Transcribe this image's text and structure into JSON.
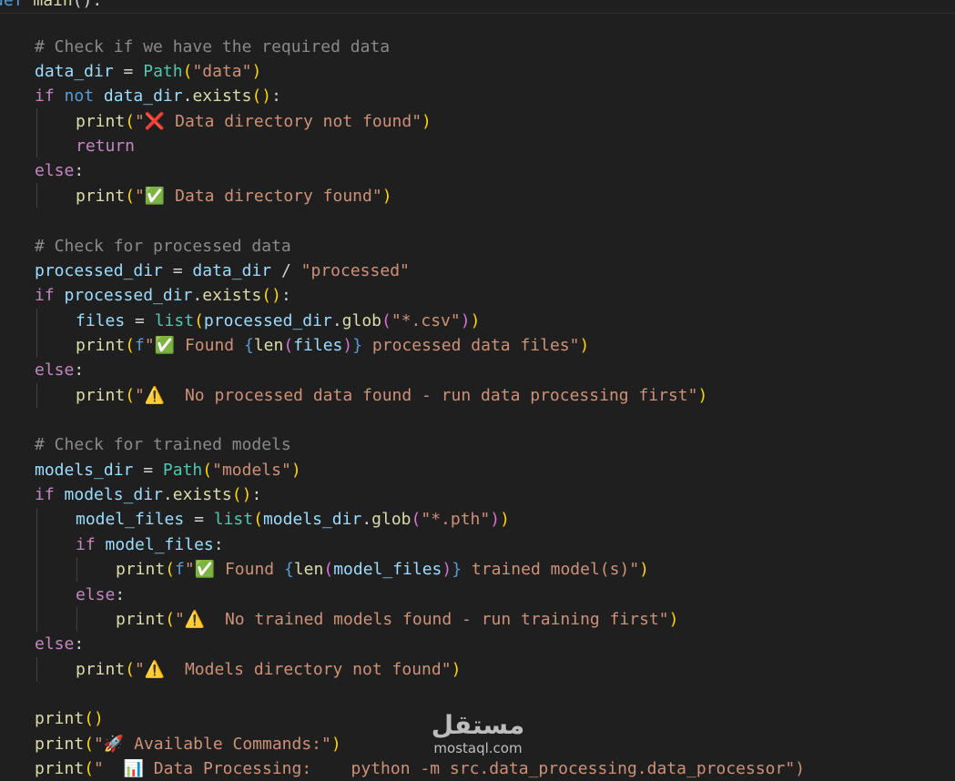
{
  "editor": {
    "sticky_header": {
      "kw": "def",
      "fn": "main",
      "rest": "():"
    },
    "cm1": "# Check if we have the required data",
    "cm2": "# Check for processed data",
    "cm3": "# Check for trained models",
    "s_data": "\"data\"",
    "s_not_found": "\"❌ Data directory not found\"",
    "s_found": "\"✅ Data directory found\"",
    "s_processed": "\"processed\"",
    "s_csv": "\"*.csv\"",
    "s_f_found_a": "\"✅ Found ",
    "s_f_found_b": " processed data files\"",
    "s_no_processed": "\"⚠️  No processed data found - run data processing first\"",
    "s_models": "\"models\"",
    "s_pth": "\"*.pth\"",
    "s_model_found_b": " trained model(s)\"",
    "s_no_models": "\"⚠️  No trained models found - run training first\"",
    "s_models_missing": "\"⚠️  Models directory not found\"",
    "s_commands": "\"🚀 Available Commands:\"",
    "s_dp": "\"  📊 Data Processing:    python -m src.data_processing.data_processor\")"
  },
  "watermark": {
    "arabic": "مستقل",
    "latin": "mostaql.com"
  }
}
